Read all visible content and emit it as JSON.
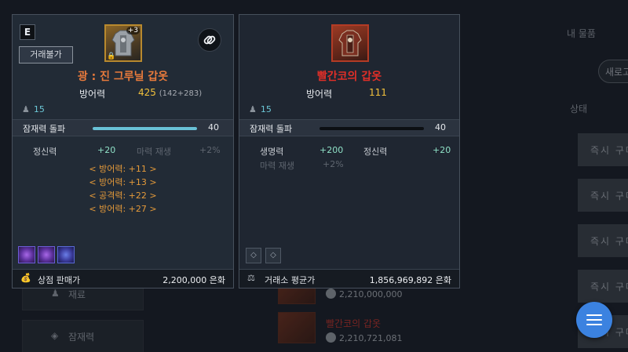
{
  "background": {
    "tab_label": "내 물품",
    "refresh_label": "새로고",
    "status_header": "상태",
    "buy_label": "즉시 구매",
    "left_rows": [
      {
        "icon": "pawn-icon",
        "label": "재료"
      },
      {
        "icon": "diamond-icon",
        "label": "잠재력"
      }
    ],
    "list_items": [
      {
        "name": "",
        "price": "2,210,000,000"
      },
      {
        "name": "빨간코의 갑옷",
        "price": "2,210,721,081"
      }
    ]
  },
  "left_card": {
    "grade": "E",
    "trade_badge": "거래불가",
    "enhance": "+3",
    "name": "광 : 진 그루닐 갑옷",
    "defense_label": "방어력",
    "defense_value": "425",
    "defense_detail": "(142+283)",
    "level": "15",
    "potential_label": "잠재력 돌파",
    "potential_fill": 1.0,
    "potential_value": "40",
    "stats": [
      {
        "label": "정신력",
        "value": "+20"
      },
      {
        "label": "마력 재생",
        "value": "+2%"
      }
    ],
    "bonuses": [
      "< 방어력: +11 >",
      "< 방어력: +13 >",
      "< 공격력: +22 >",
      "< 방어력: +27 >"
    ],
    "footer_label": "상점 판매가",
    "footer_value": "2,200,000 은화"
  },
  "right_card": {
    "name": "빨간코의 갑옷",
    "defense_label": "방어력",
    "defense_value": "111",
    "level": "15",
    "potential_label": "잠재력 돌파",
    "potential_fill": 0.0,
    "potential_value": "40",
    "stats": [
      {
        "label": "생명력",
        "value": "+200"
      },
      {
        "label": "정신력",
        "value": "+20"
      },
      {
        "label": "마력 재생",
        "value": "+2%"
      }
    ],
    "footer_label": "거래소 평균가",
    "footer_value": "1,856,969,892 은화"
  },
  "colors": {
    "accent_blue": "#3b82e0",
    "item_orange": "#e87a3c",
    "item_red": "#e02f28",
    "stat_green": "#8fe0c6",
    "defense_gold": "#f2c13c"
  }
}
